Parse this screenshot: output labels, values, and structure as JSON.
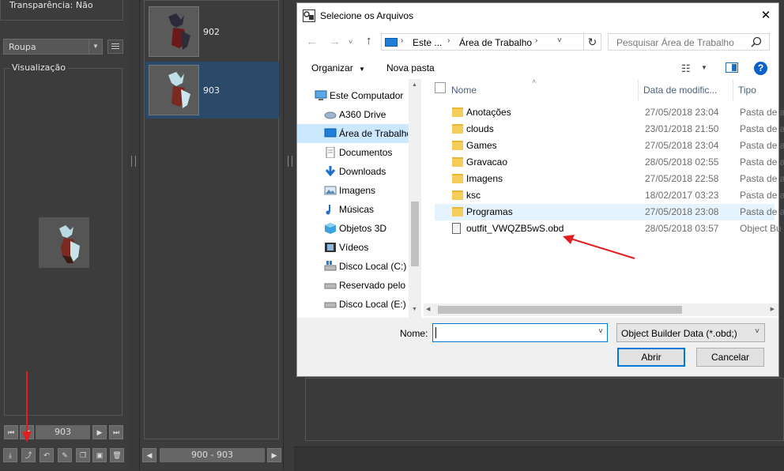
{
  "left_panel": {
    "transparency_label": "Transparência: Não",
    "category_select": "Roupa",
    "preview_title": "Visualização",
    "frame_value": "903"
  },
  "middle_panel": {
    "items": [
      {
        "id": "902",
        "selected": false
      },
      {
        "id": "903",
        "selected": true
      }
    ],
    "range_label": "900 - 903"
  },
  "dialog": {
    "title": "Selecione os Arquivos",
    "close_glyph": "✕",
    "breadcrumb": [
      "Este ...",
      "Área de Trabalho"
    ],
    "search_placeholder": "Pesquisar Área de Trabalho",
    "organize_label": "Organizar",
    "new_folder_label": "Nova pasta",
    "nav_items": [
      {
        "label": "Este Computador",
        "icon": "computer-icon",
        "indent": 0,
        "selected": false
      },
      {
        "label": "A360 Drive",
        "icon": "cloud-drive-icon",
        "indent": 1,
        "selected": false
      },
      {
        "label": "Área de Trabalho",
        "icon": "desktop-icon",
        "indent": 1,
        "selected": true
      },
      {
        "label": "Documentos",
        "icon": "document-icon",
        "indent": 1,
        "selected": false
      },
      {
        "label": "Downloads",
        "icon": "download-icon",
        "indent": 1,
        "selected": false
      },
      {
        "label": "Imagens",
        "icon": "image-icon",
        "indent": 1,
        "selected": false
      },
      {
        "label": "Músicas",
        "icon": "music-icon",
        "indent": 1,
        "selected": false
      },
      {
        "label": "Objetos 3D",
        "icon": "cube-icon",
        "indent": 1,
        "selected": false
      },
      {
        "label": "Vídeos",
        "icon": "video-icon",
        "indent": 1,
        "selected": false
      },
      {
        "label": "Disco Local (C:)",
        "icon": "windows-drive-icon",
        "indent": 1,
        "selected": false
      },
      {
        "label": "Reservado pelo S",
        "icon": "drive-icon",
        "indent": 1,
        "selected": false
      },
      {
        "label": "Disco Local (E:)",
        "icon": "drive-icon",
        "indent": 1,
        "selected": false
      }
    ],
    "columns": {
      "name": "Nome",
      "date": "Data de modific...",
      "type": "Tipo"
    },
    "files": [
      {
        "name": "Anotações",
        "date": "27/05/2018 23:04",
        "type": "Pasta de a",
        "kind": "folder",
        "highlight": false
      },
      {
        "name": "clouds",
        "date": "23/01/2018 21:50",
        "type": "Pasta de a",
        "kind": "folder",
        "highlight": false
      },
      {
        "name": "Games",
        "date": "27/05/2018 23:04",
        "type": "Pasta de a",
        "kind": "folder",
        "highlight": false
      },
      {
        "name": "Gravacao",
        "date": "28/05/2018 02:55",
        "type": "Pasta de a",
        "kind": "folder",
        "highlight": false
      },
      {
        "name": "Imagens",
        "date": "27/05/2018 22:58",
        "type": "Pasta de a",
        "kind": "folder",
        "highlight": false
      },
      {
        "name": "ksc",
        "date": "18/02/2017 03:23",
        "type": "Pasta de a",
        "kind": "folder",
        "highlight": false
      },
      {
        "name": "Programas",
        "date": "27/05/2018 23:08",
        "type": "Pasta de a",
        "kind": "folder",
        "highlight": true
      },
      {
        "name": "outfit_VWQZB5wS.obd",
        "date": "28/05/2018 03:57",
        "type": "Object Bu",
        "kind": "file",
        "highlight": false
      }
    ],
    "filename_label": "Nome:",
    "filename_value": "",
    "filter_value": "Object Builder Data (*.obd;)",
    "open_label": "Abrir",
    "cancel_label": "Cancelar"
  },
  "colors": {
    "annotation_arrow": "#e02020",
    "selection_blue": "#cce8ff",
    "app_selected": "#2b4a6a",
    "help_blue": "#0a64c8"
  }
}
